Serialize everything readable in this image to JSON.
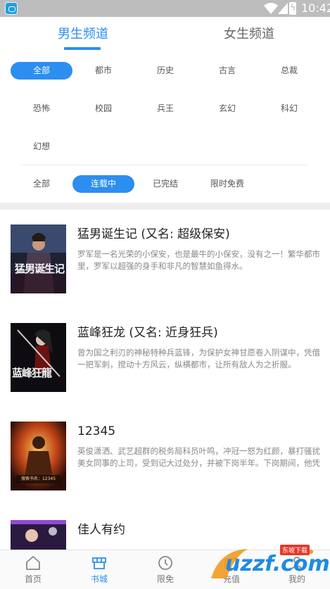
{
  "status_bar": {
    "time": "10:42",
    "icons": [
      "app-icon",
      "wifi-icon",
      "signal-icon",
      "battery-charging-icon"
    ]
  },
  "tabs": [
    {
      "label": "男生频道",
      "active": true
    },
    {
      "label": "女生频道",
      "active": false
    }
  ],
  "genres": [
    "全部",
    "都市",
    "历史",
    "古言",
    "总裁",
    "恐怖",
    "校园",
    "兵王",
    "玄幻",
    "科幻",
    "幻想"
  ],
  "genre_selected": "全部",
  "status_filters": [
    "全部",
    "连载中",
    "已完结",
    "限时免费"
  ],
  "status_selected": "连载中",
  "books": [
    {
      "title": "猛男诞生记 (又名: 超级保安)",
      "description": "罗军是一名光荣的小保安，也是最牛的小保安，没有之一！繁华都市里，罗军以超强的身手和非凡的智慧如鱼得水。",
      "cover_text": "猛男诞生记"
    },
    {
      "title": "蓝峰狂龙 (又名: 近身狂兵)",
      "description": "曾为国之利刃的神秘特种兵蓝锋，为保护女神甘愿卷入阴谋中，凭借一把军刺，搅动十方风云，纵横都市，让所有敌人为之折服。",
      "cover_text": "蓝峰狂龍"
    },
    {
      "title": "12345",
      "description": "英俊潇洒、武艺超群的税务局科员叶鸣，冲冠一怒为红颜，暴打骚扰美女同事的上司，受到记大过处分，并被下岗半年。下岗期间，他凭借高超的武功，救下了被杀手围攻的省纪委副书记，并...",
      "cover_text": "搜索书名：12345"
    },
    {
      "title": "佳人有约",
      "description": "",
      "cover_text": ""
    }
  ],
  "bottom_nav": [
    {
      "label": "首页",
      "icon": "home-icon",
      "active": false
    },
    {
      "label": "书城",
      "icon": "bookstore-icon",
      "active": true
    },
    {
      "label": "限免",
      "icon": "clock-icon",
      "active": false
    },
    {
      "label": "充值",
      "icon": "wallet-icon",
      "active": false
    },
    {
      "label": "我的",
      "icon": "user-icon",
      "active": false
    }
  ],
  "watermark": {
    "text": "uzzf.com",
    "sub": "东坡下载"
  },
  "colors": {
    "accent": "#2b8ef0",
    "status_bar": "#bdbdbd"
  }
}
